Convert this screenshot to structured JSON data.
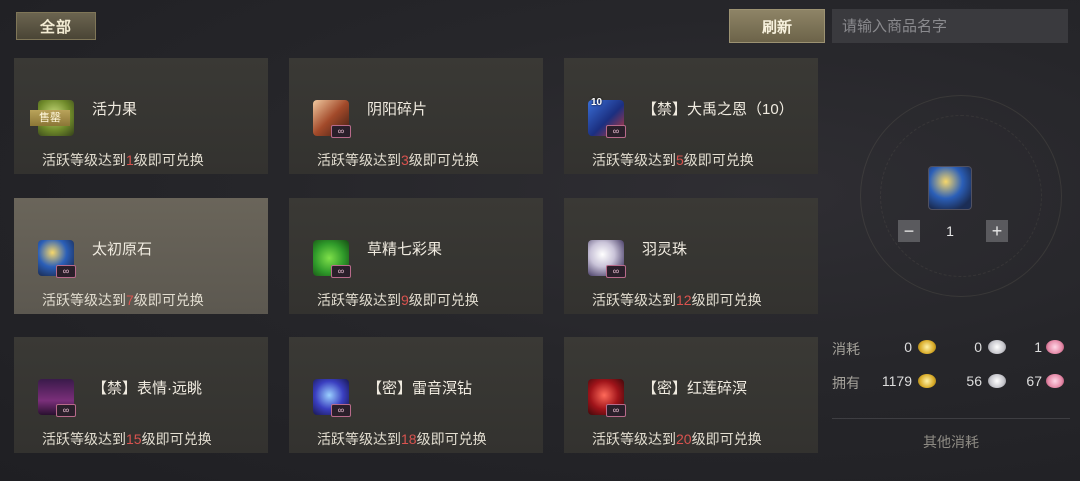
{
  "filter": {
    "all_label": "全部"
  },
  "header": {
    "refresh_label": "刷新",
    "search_placeholder": "请输入商品名字"
  },
  "items": [
    {
      "name": "活力果",
      "req_prefix": "活跃等级达到",
      "level": "1",
      "req_suffix": "级即可兑换",
      "badge": "售罄",
      "icon": "green-fruit-icon"
    },
    {
      "name": "阴阳碎片",
      "req_prefix": "活跃等级达到",
      "level": "3",
      "req_suffix": "级即可兑换",
      "icon": "shard-icon"
    },
    {
      "name": "【禁】大禹之恩（10）",
      "req_prefix": "活跃等级达到",
      "level": "5",
      "req_suffix": "级即可兑换",
      "quantity": "10",
      "icon": "blue-scroll-icon"
    },
    {
      "name": "太初原石",
      "req_prefix": "活跃等级达到",
      "level": "7",
      "req_suffix": "级即可兑换",
      "icon": "origin-stone-icon"
    },
    {
      "name": "草精七彩果",
      "req_prefix": "活跃等级达到",
      "level": "9",
      "req_suffix": "级即可兑换",
      "icon": "rainbow-fruit-icon"
    },
    {
      "name": "羽灵珠",
      "req_prefix": "活跃等级达到",
      "level": "12",
      "req_suffix": "级即可兑换",
      "icon": "pearl-icon"
    },
    {
      "name": "【禁】表情·远眺",
      "req_prefix": "活跃等级达到",
      "level": "15",
      "req_suffix": "级即可兑换",
      "icon": "emote-icon"
    },
    {
      "name": "【密】雷音溟钻",
      "req_prefix": "活跃等级达到",
      "level": "18",
      "req_suffix": "级即可兑换",
      "icon": "thunder-gem-icon"
    },
    {
      "name": "【密】红莲碎溟",
      "req_prefix": "活跃等级达到",
      "level": "20",
      "req_suffix": "级即可兑换",
      "icon": "red-lotus-icon"
    }
  ],
  "selected_index": 3,
  "panel": {
    "quantity": "1",
    "minus_label": "−",
    "plus_label": "+",
    "cost_label": "消耗",
    "owned_label": "拥有",
    "cost": {
      "gold": "0",
      "silver": "0",
      "pink": "1"
    },
    "owned": {
      "gold": "1179",
      "silver": "56",
      "pink": "67"
    },
    "other_cost_label": "其他消耗"
  },
  "colors": {
    "level_highlight": "#d9534f",
    "infinite_badge_border": "#b76a8a"
  }
}
